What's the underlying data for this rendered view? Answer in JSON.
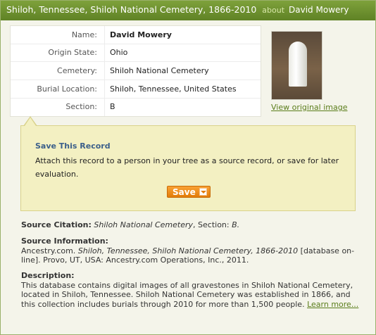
{
  "header": {
    "title": "Shiloh, Tennessee, Shiloh National Cemetery, 1866-2010",
    "about": "about",
    "person": "David Mowery"
  },
  "fields": [
    {
      "label": "Name:",
      "value": "David Mowery"
    },
    {
      "label": "Origin State:",
      "value": "Ohio"
    },
    {
      "label": "Cemetery:",
      "value": "Shiloh National Cemetery"
    },
    {
      "label": "Burial Location:",
      "value": "Shiloh, Tennessee, United States"
    },
    {
      "label": "Section:",
      "value": "B"
    }
  ],
  "image": {
    "link_label": "View original image"
  },
  "save": {
    "heading": "Save This Record",
    "text": "Attach this record to a person in your tree as a source record, or save for later evaluation.",
    "button_label": "Save"
  },
  "citation": {
    "label": "Source Citation:",
    "cemetery": "Shiloh National Cemetery",
    "section_text": ", Section:",
    "section_value": "B."
  },
  "source_info": {
    "label": "Source Information:",
    "prefix": "Ancestry.com.",
    "title": "Shiloh, Tennessee, Shiloh National Cemetery, 1866-2010",
    "suffix": "[database on-line]. Provo, UT, USA: Ancestry.com Operations, Inc., 2011."
  },
  "description": {
    "label": "Description:",
    "text": "This database contains digital images of all gravestones in Shiloh National Cemetery, located in Shiloh, Tennessee. Shiloh National Cemetery was established in 1866, and this collection includes burials through 2010 for more than 1,500 people.",
    "learn_more": "Learn more..."
  },
  "colors": {
    "title_bar": "#6b8e2c",
    "save_box": "#f3f0c2",
    "save_button": "#ef8d1c",
    "link": "#5a7d1a"
  }
}
